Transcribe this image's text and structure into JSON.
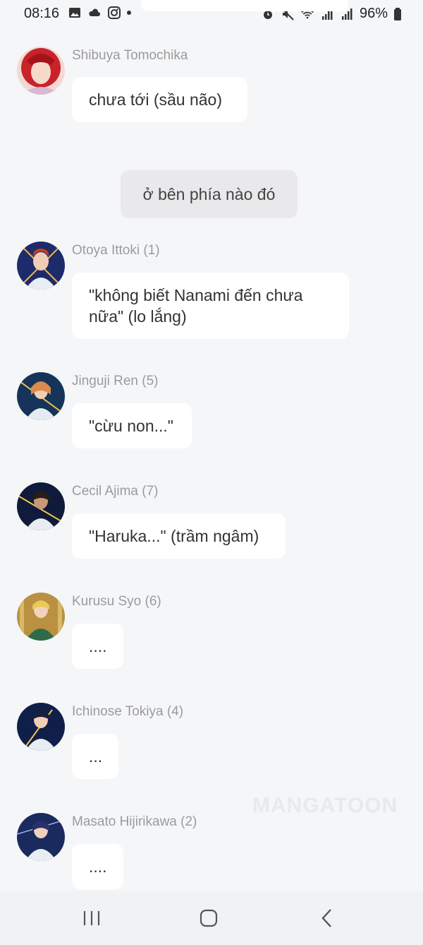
{
  "status_bar": {
    "time": "08:16",
    "left_icons": [
      "image-icon",
      "cloud-icon",
      "instagram-icon",
      "dot-icon"
    ],
    "right_icons": [
      "alarm-icon",
      "mute-icon",
      "wifi-icon",
      "signal-icon",
      "signal-icon"
    ],
    "battery": "96%"
  },
  "messages": [
    {
      "sender": "Shibuya Tomochika",
      "text": "chưa tới (sầu não)"
    },
    {
      "sender": "Otoya Ittoki (1)",
      "text_line1": "\"không biết Nanami đến chưa",
      "text_line2": "nữa\" (lo lắng)"
    },
    {
      "sender": "Jinguji Ren (5)",
      "text": "\"cừu non...\""
    },
    {
      "sender": "Cecil Ajima (7)",
      "text": "\"Haruka...\" (trầm ngâm)"
    },
    {
      "sender": "Kurusu Syo (6)",
      "text": "...."
    },
    {
      "sender": "Ichinose Tokiya (4)",
      "text": "..."
    },
    {
      "sender": "Masato Hijirikawa (2)",
      "text": "...."
    }
  ],
  "narration": "ở bên phía nào đó",
  "watermark": "MANGATOON",
  "colors": {
    "background": "#f5f6f8",
    "bubble": "#ffffff",
    "narration": "#e9e9eb",
    "sender": "#9b9b9b"
  }
}
